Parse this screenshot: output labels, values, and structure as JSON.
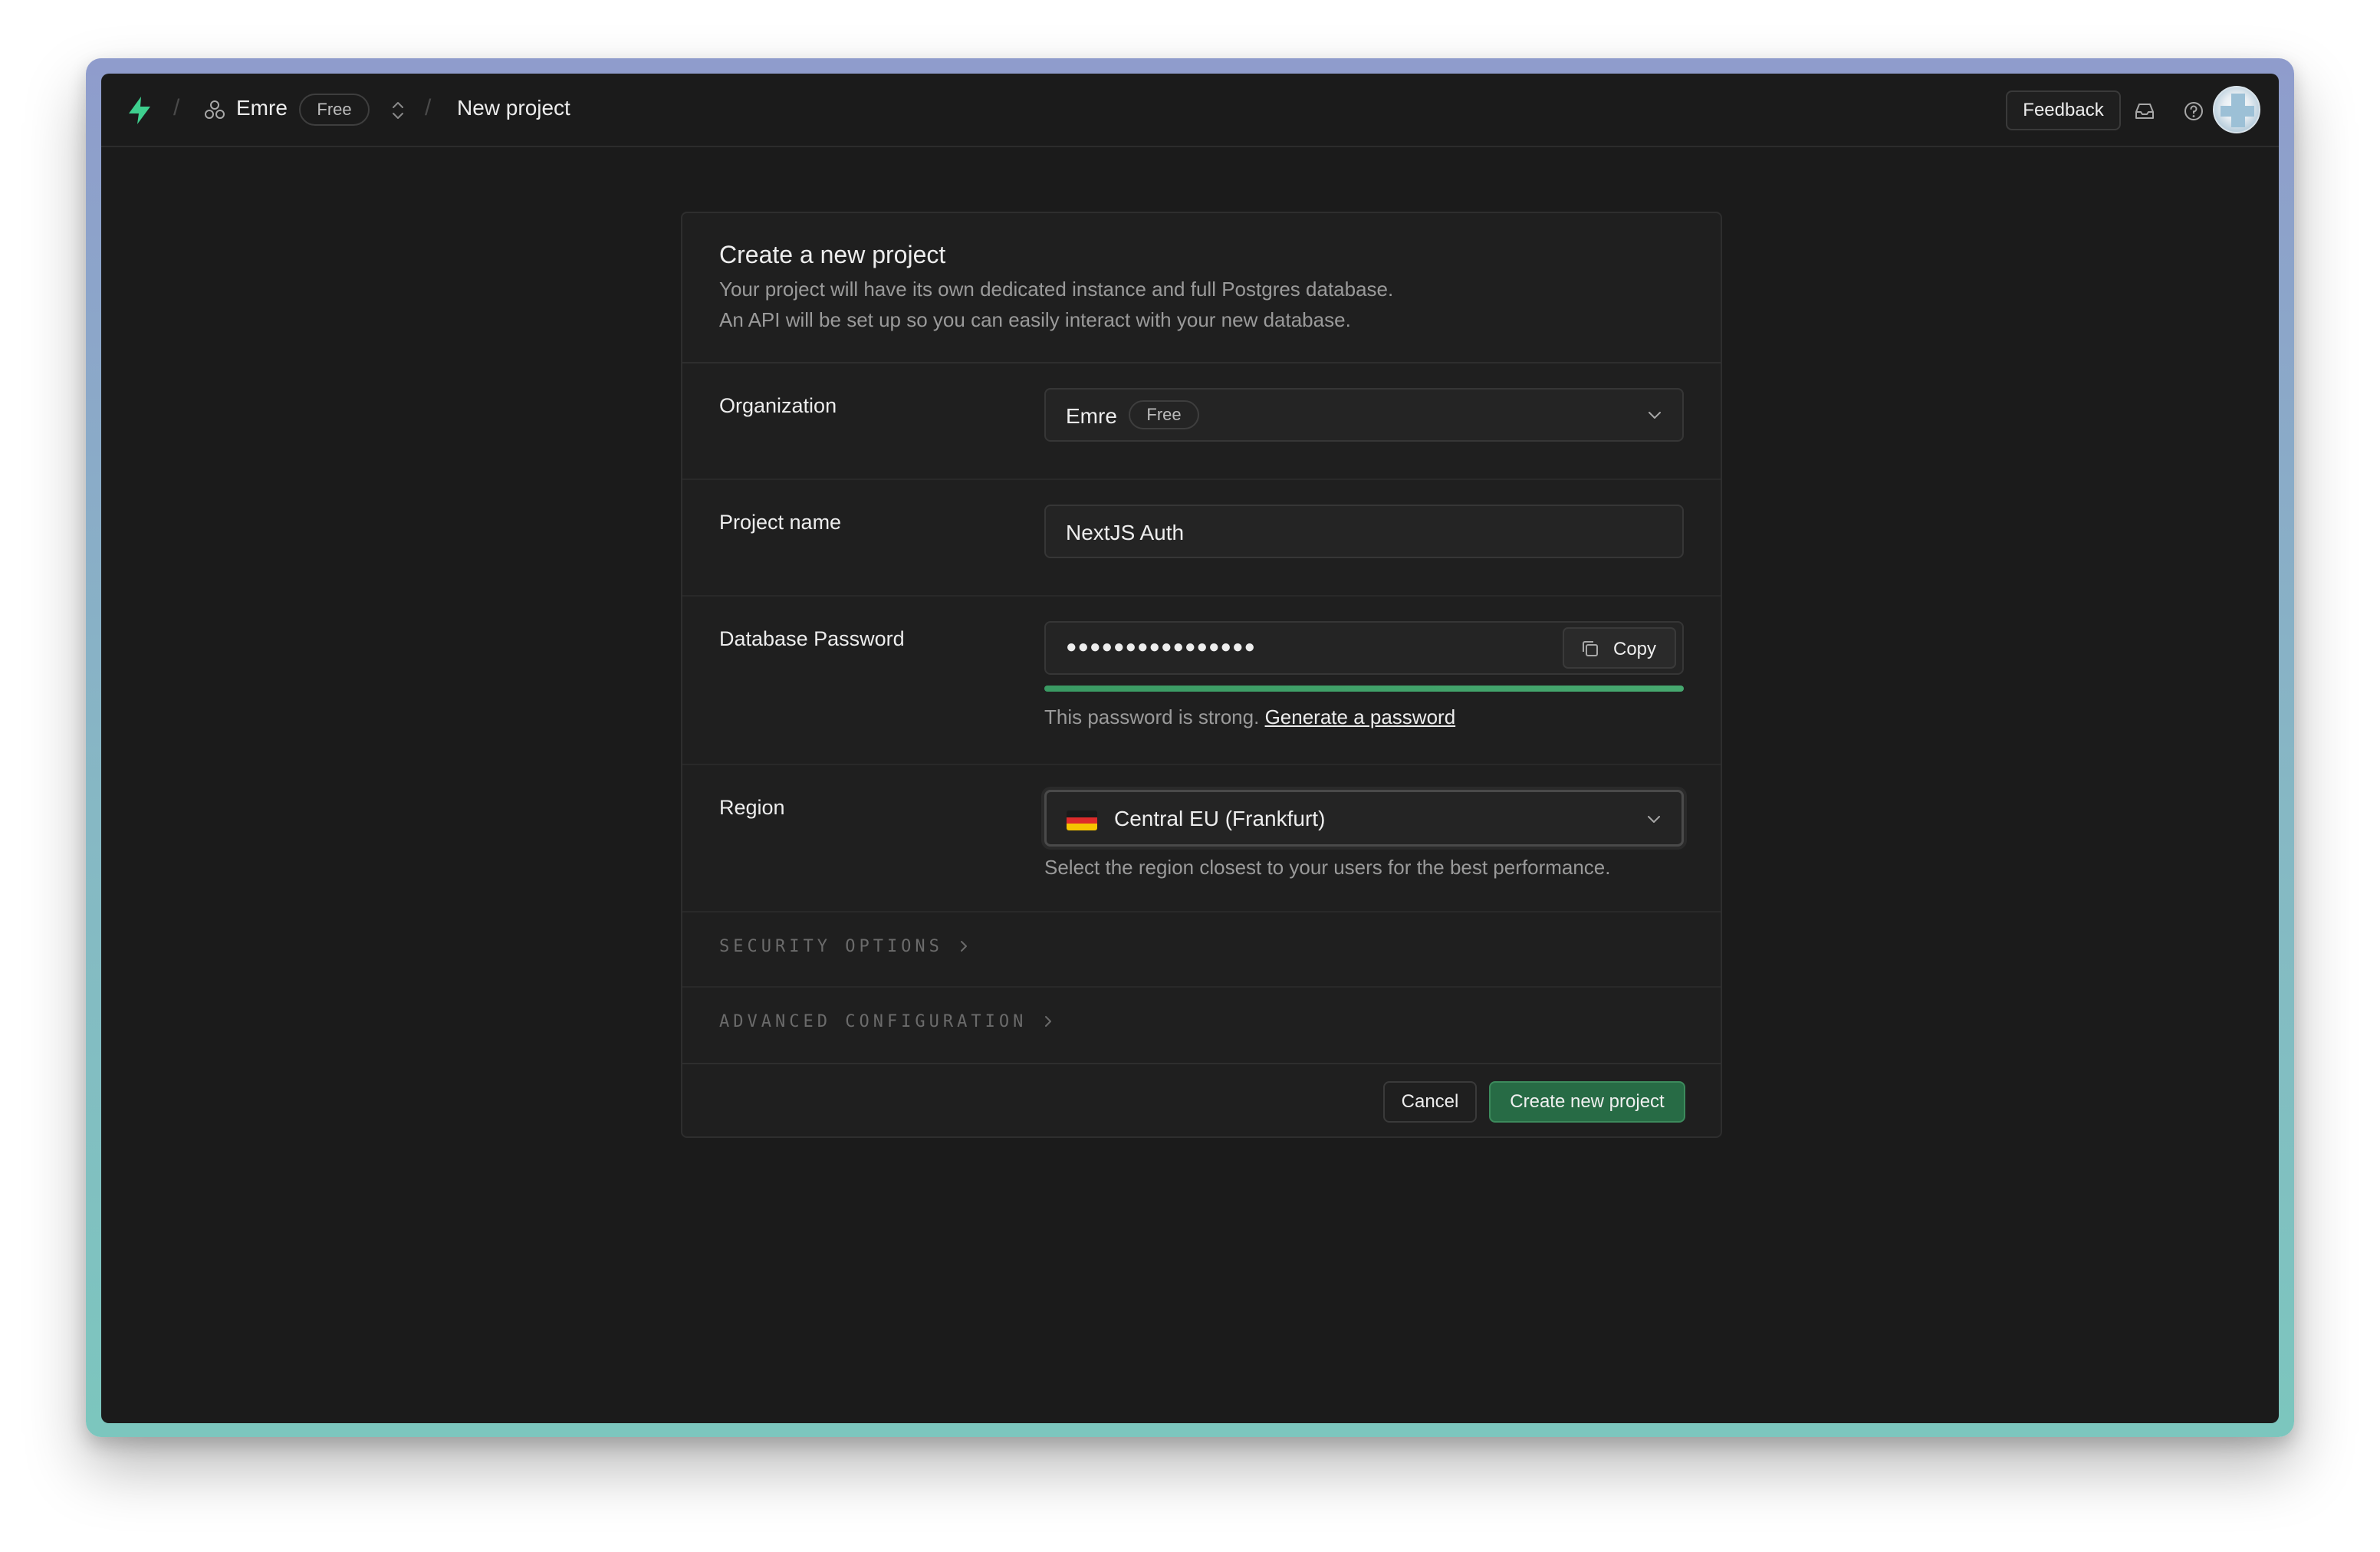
{
  "topbar": {
    "org_name": "Emre",
    "plan_badge": "Free",
    "breadcrumb_page": "New project",
    "feedback_label": "Feedback",
    "brand_color": "#3ecf8e"
  },
  "card": {
    "title": "Create a new project",
    "description_line1": "Your project will have its own dedicated instance and full Postgres database.",
    "description_line2": "An API will be set up so you can easily interact with your new database."
  },
  "form": {
    "organization": {
      "label": "Organization",
      "value": "Emre",
      "badge": "Free"
    },
    "project_name": {
      "label": "Project name",
      "value": "NextJS Auth"
    },
    "database_password": {
      "label": "Database Password",
      "masked_value": "●●●●●●●●●●●●●●●●",
      "copy_label": "Copy",
      "strength_fraction": 1.0,
      "strength_text": "This password is strong.",
      "generate_link": "Generate a password"
    },
    "region": {
      "label": "Region",
      "value": "Central EU (Frankfurt)",
      "hint": "Select the region closest to your users for the best performance."
    }
  },
  "sections": {
    "security_options": "SECURITY OPTIONS",
    "advanced_configuration": "ADVANCED CONFIGURATION"
  },
  "footer": {
    "cancel_label": "Cancel",
    "create_label": "Create new project"
  }
}
